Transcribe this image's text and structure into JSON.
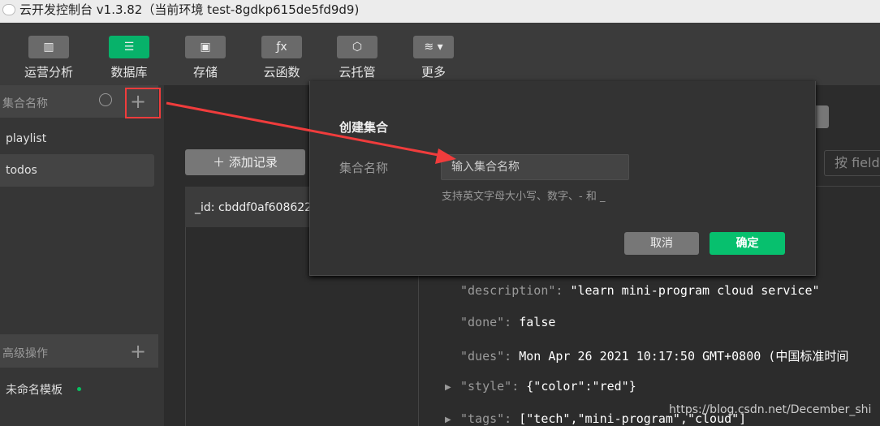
{
  "window": {
    "title": "云开发控制台 v1.3.82（当前环境 test-8gdkp615de5fd9d9)"
  },
  "toolbar": {
    "items": [
      {
        "label": "运营分析",
        "icon": "chart-icon",
        "glyph": "▥"
      },
      {
        "label": "数据库",
        "icon": "database-icon",
        "glyph": "☰",
        "active": true
      },
      {
        "label": "存储",
        "icon": "floppy-icon",
        "glyph": "▣"
      },
      {
        "label": "云函数",
        "icon": "function-icon",
        "glyph": "ƒx"
      },
      {
        "label": "云托管",
        "icon": "cube-icon",
        "glyph": "⬡"
      },
      {
        "label": "更多",
        "icon": "layers-icon",
        "glyph": "≋ ▾"
      }
    ]
  },
  "sidebar": {
    "collection_header": "集合名称",
    "collections": [
      "playlist",
      "todos"
    ],
    "advanced_header": "高级操作",
    "templates": [
      {
        "label": "未命名模板",
        "status_color": "#07c160"
      }
    ]
  },
  "main": {
    "add_record": "添加记录",
    "record_id": "_id: cbddf0af608622",
    "search_placeholder": "按 field",
    "fields": [
      {
        "key": "\"description\":",
        "value": "\"learn mini-program cloud service\""
      },
      {
        "key": "\"done\":",
        "value": "false"
      },
      {
        "key": "\"dues\":",
        "value": "Mon Apr 26 2021 10:17:50 GMT+0800 (中国标准时间"
      },
      {
        "key": "\"style\":",
        "value": "{\"color\":\"red\"}",
        "expandable": true
      },
      {
        "key": "\"tags\":",
        "value": "[\"tech\",\"mini-program\",\"cloud\"]",
        "expandable": true
      }
    ]
  },
  "modal": {
    "title": "创建集合",
    "label": "集合名称",
    "placeholder": "输入集合名称",
    "hint": "支持英文字母大小写、数字、- 和 _",
    "cancel": "取消",
    "confirm": "确定"
  },
  "watermark": "https://blog.csdn.net/December_shi",
  "colors": {
    "accent": "#07c06e",
    "annotation": "#f03c3c"
  }
}
